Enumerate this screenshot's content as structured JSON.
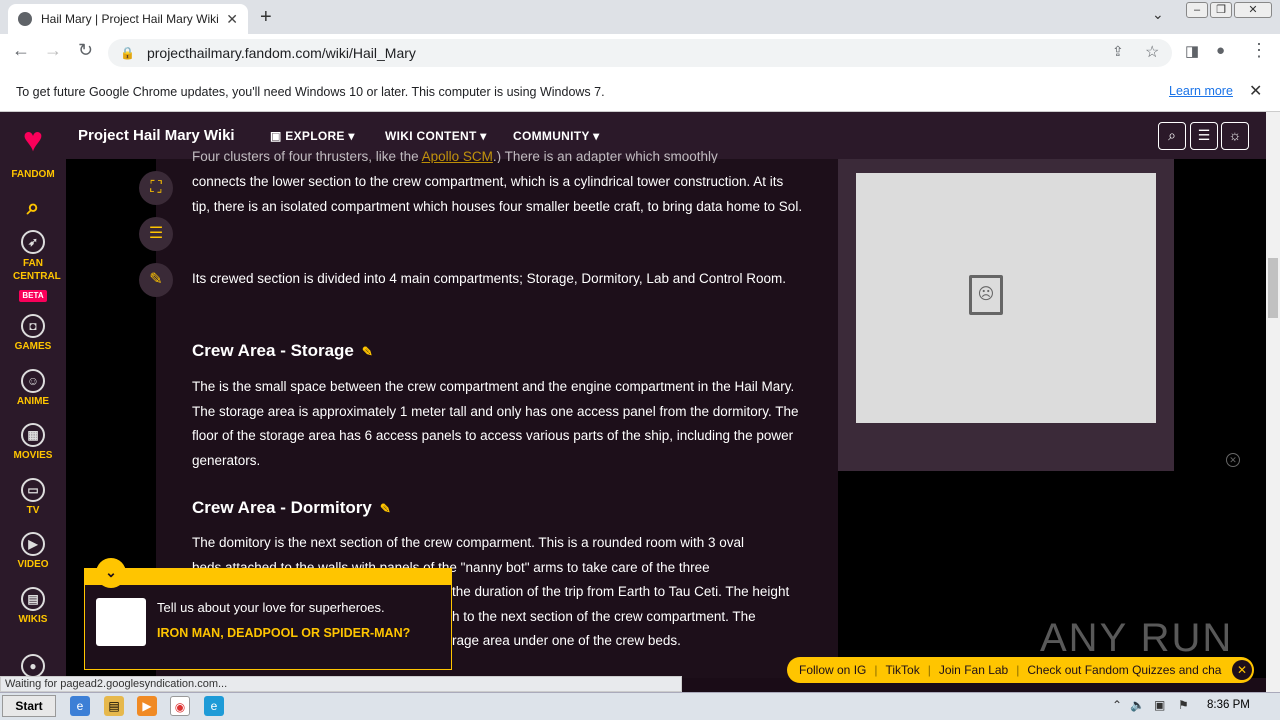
{
  "browser": {
    "tab_title": "Hail Mary | Project Hail Mary Wiki | F",
    "url": "projecthailmary.fandom.com/wiki/Hail_Mary",
    "infobar_text": "To get future Google Chrome updates, you'll need Windows 10 or later. This computer is using Windows 7.",
    "infobar_link": "Learn more",
    "status_text": "Waiting for pagead2.googlesyndication.com..."
  },
  "rail": {
    "fandom": "FANDOM",
    "fan_central": "FAN CENTRAL",
    "beta": "BETA",
    "games": "GAMES",
    "anime": "ANIME",
    "movies": "MOVIES",
    "tv": "TV",
    "video": "VIDEO",
    "wikis": "WIKIS"
  },
  "wiki": {
    "title": "Project Hail Mary Wiki",
    "nav": [
      "EXPLORE",
      "WIKI CONTENT",
      "COMMUNITY"
    ]
  },
  "article": {
    "partial_top_a": "Four clusters of four thrusters, like the ",
    "partial_top_link": "Apollo SCM",
    "partial_top_b": ".) There is an adapter which smoothly",
    "intro": "connects the lower section to the crew compartment, which is a cylindrical tower construction. At its tip, there is an isolated compartment which houses four smaller beetle craft, to bring data home to Sol.",
    "compartments": "Its crewed section is divided into 4 main compartments; Storage, Dormitory, Lab and Control Room.",
    "h_storage": "Crew Area - Storage",
    "storage": "The is the small space between the crew compartment and the engine compartment in the Hail Mary. The storage area is approximately 1 meter tall and only has one access panel from the dormitory. The floor of the storage area has 6 access panels to access various parts of the ship, including the power generators.",
    "h_dormitory": "Crew Area - Dormitory",
    "dorm_line1": "The domitory is the next section of the crew comparment. This is a rounded room with 3 oval",
    "dorm_line2": "beds attached to the walls with panels of the \"nanny bot\" arms to take care of the three",
    "dorm_line3": "the duration of the trip from Earth to Tau Ceti. The height",
    "dorm_line4": "h to the next section of the crew compartment. The",
    "dorm_line5": "rage area under one of the crew beds."
  },
  "popup": {
    "question": "Tell us about your love for superheroes.",
    "answer": "IRON MAN, DEADPOOL OR SPIDER-MAN?"
  },
  "footer_bar": [
    "Follow on IG",
    "TikTok",
    "Join Fan Lab",
    "Check out Fandom Quizzes and cha"
  ],
  "watermark": "ANY RUN",
  "taskbar": {
    "start": "Start",
    "clock": "8:36 PM"
  }
}
